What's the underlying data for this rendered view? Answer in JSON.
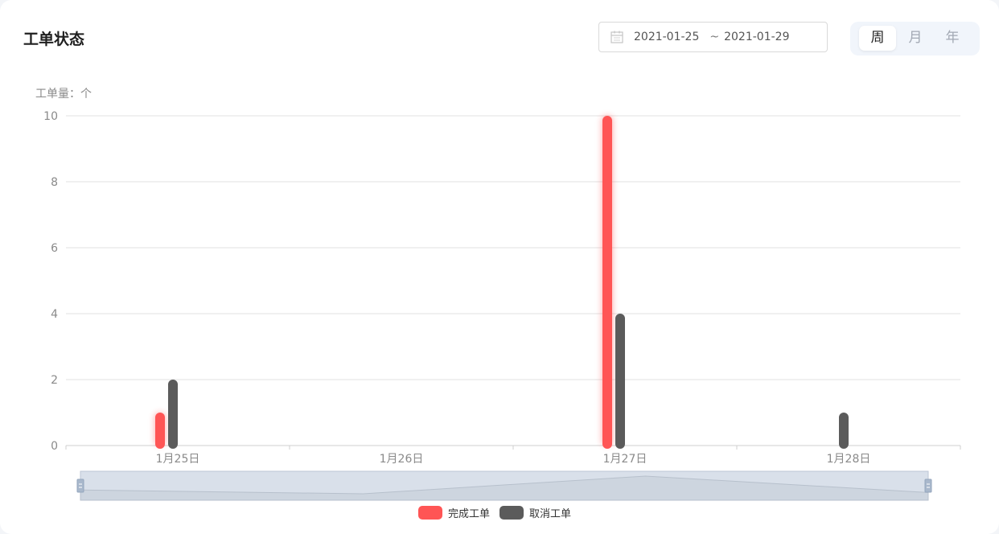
{
  "card": {
    "title": "工单状态",
    "date_range": {
      "start": "2021-01-25",
      "separator": "~",
      "end": "2021-01-29"
    },
    "period_options": [
      "周",
      "月",
      "年"
    ],
    "active_period": "周",
    "icons": {
      "date": "calendar-icon"
    }
  },
  "chart_data": {
    "type": "bar",
    "ylabel": "工单量：个",
    "ylim": [
      0,
      10
    ],
    "yticks": [
      0,
      2,
      4,
      6,
      8,
      10
    ],
    "categories": [
      "1月25日",
      "1月26日",
      "1月27日",
      "1月28日"
    ],
    "series": [
      {
        "name": "完成工单",
        "color": "#ff5555",
        "values": [
          1,
          0,
          10,
          0
        ]
      },
      {
        "name": "取消工单",
        "color": "#5b5b5b",
        "values": [
          2,
          0,
          4,
          1
        ]
      }
    ],
    "grid": true,
    "legend_position": "bottom-center",
    "data_zoom_slider": true
  }
}
